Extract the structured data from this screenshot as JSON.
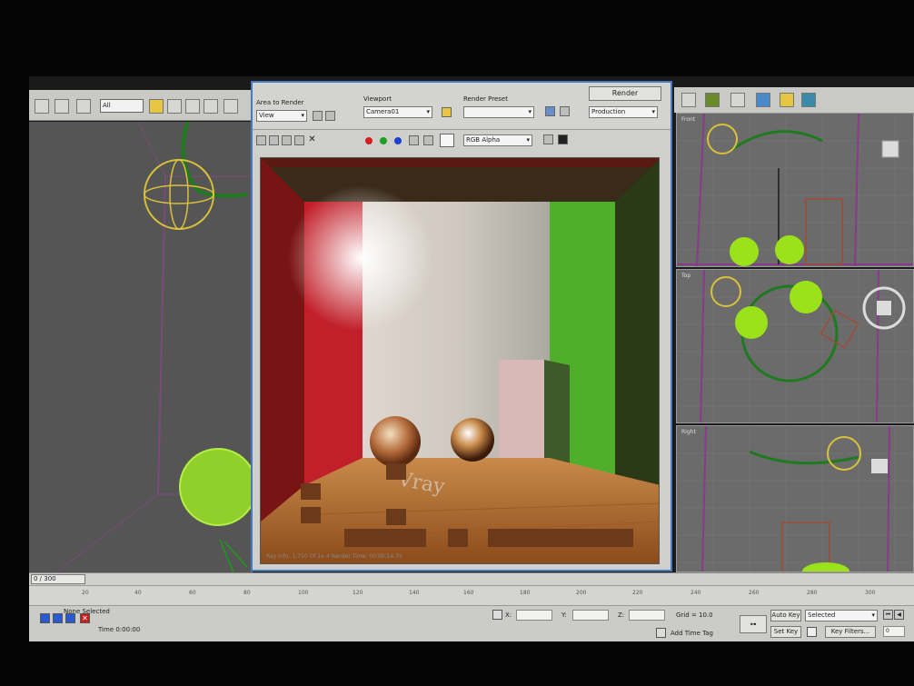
{
  "main_toolbar": {
    "selection_filter": "All"
  },
  "render_window": {
    "area_to_render_label": "Area to Render",
    "area_to_render_value": "View",
    "viewport_label": "Viewport",
    "viewport_value": "Camera01",
    "render_preset_label": "Render Preset",
    "render_preset_value": "",
    "render_button": "Render",
    "production_value": "Production",
    "channel_value": "RGB Alpha",
    "status_text": "Ray Info: 1,750 Of 1e 4 Render Time: 00:00:14.75",
    "floor_logo_text": "Vray",
    "colors": {
      "left_wall": "#c1202a",
      "right_wall": "#4fae2a",
      "floor": "#b86a2a",
      "frame": "#4a79c4"
    }
  },
  "viewports": {
    "left": {
      "label": ""
    },
    "right_top": {
      "label": "Front"
    },
    "right_mid": {
      "label": "Top"
    },
    "right_bottom": {
      "label": "Right"
    }
  },
  "timeline": {
    "slider_text": "0 / 300",
    "ticks": [
      "20",
      "40",
      "60",
      "80",
      "100",
      "120",
      "140",
      "160",
      "180",
      "200",
      "220",
      "240",
      "260",
      "280",
      "300"
    ]
  },
  "statusbar": {
    "selection_status": "None Selected",
    "time_text": "Time  0:00:00",
    "x_label": "X:",
    "y_label": "Y:",
    "z_label": "Z:",
    "grid_text": "Grid = 10.0",
    "add_time_tag": "Add Time Tag",
    "auto_key": "Auto Key",
    "auto_key_value": "Selected",
    "set_key": "Set Key",
    "key_filters": "Key Filters...",
    "frame_value": "0"
  }
}
